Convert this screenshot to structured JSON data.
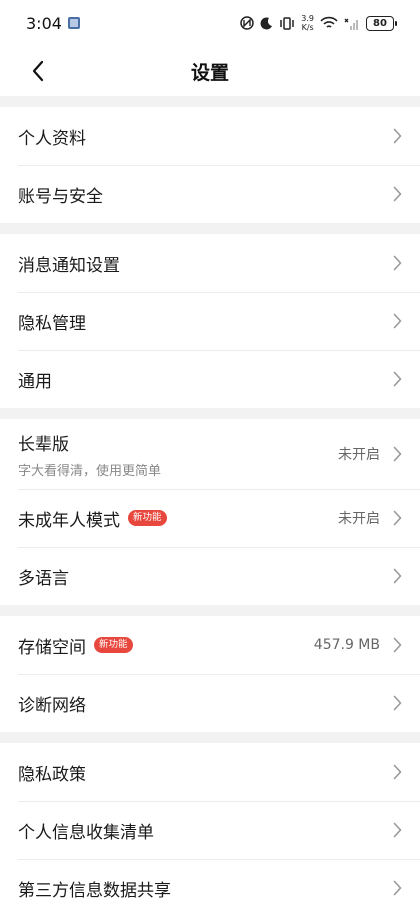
{
  "status_bar": {
    "time": "3:04",
    "net_speed_value": "3.9",
    "net_speed_unit": "K/s",
    "battery": "80"
  },
  "header": {
    "title": "设置",
    "back_icon": "chevron-left-icon"
  },
  "groups": [
    {
      "items": [
        {
          "label": "个人资料"
        },
        {
          "label": "账号与安全"
        }
      ]
    },
    {
      "items": [
        {
          "label": "消息通知设置"
        },
        {
          "label": "隐私管理"
        },
        {
          "label": "通用"
        }
      ]
    },
    {
      "items": [
        {
          "label": "长辈版",
          "subtitle": "字大看得清，使用更简单",
          "value": "未开启"
        },
        {
          "label": "未成年人模式",
          "badge": "新功能",
          "value": "未开启"
        },
        {
          "label": "多语言"
        }
      ]
    },
    {
      "items": [
        {
          "label": "存储空间",
          "badge": "新功能",
          "value": "457.9 MB"
        },
        {
          "label": "诊断网络"
        }
      ]
    },
    {
      "items": [
        {
          "label": "隐私政策"
        },
        {
          "label": "个人信息收集清单"
        },
        {
          "label": "第三方信息数据共享"
        }
      ]
    }
  ],
  "colors": {
    "badge": "#e8473d",
    "background": "#f2f2f2",
    "card": "#ffffff"
  }
}
